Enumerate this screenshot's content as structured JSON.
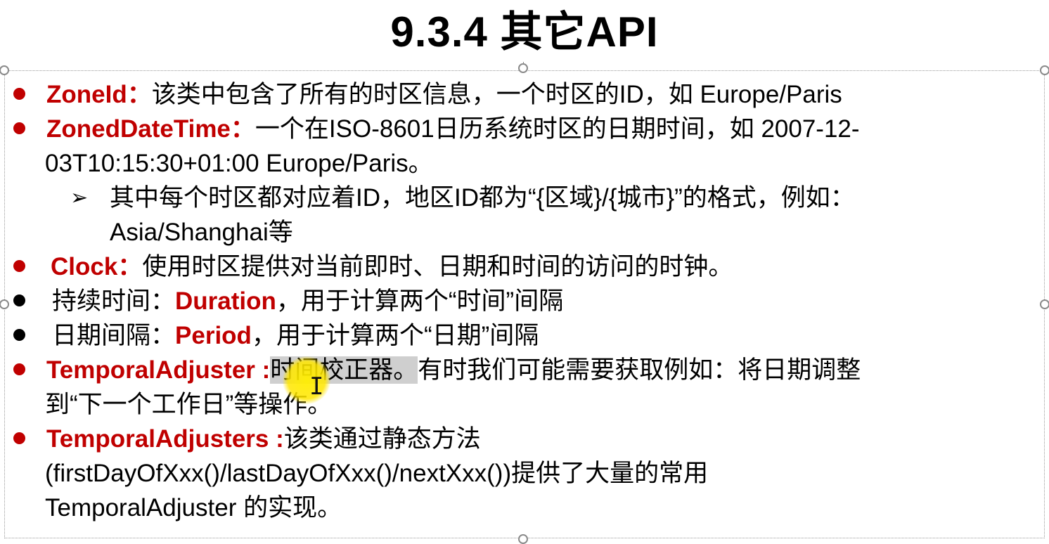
{
  "slide": {
    "title": "9.3.4 其它API",
    "items": [
      {
        "term": "ZoneId：",
        "text": "该类中包含了所有的时区信息，一个时区的ID，如 Europe/Paris"
      },
      {
        "term": "ZonedDateTime：",
        "text_line1": "一个在ISO-8601日历系统时区的日期时间，如 2007-12-",
        "text_line2": "03T10:15:30+01:00 Europe/Paris。"
      },
      {
        "sub_marker": "➢",
        "text_line1": "其中每个时区都对应着ID，地区ID都为“{区域}/{城市}”的格式，例如：",
        "text_line2": "Asia/Shanghai等"
      },
      {
        "term": "Clock：",
        "text": "使用时区提供对当前即时、日期和时间的访问的时钟。"
      },
      {
        "prefix": "持续时间：",
        "term": "Duration",
        "text": "，用于计算两个“时间”间隔"
      },
      {
        "prefix": "日期间隔：",
        "term": "Period",
        "text": "，用于计算两个“日期”间隔"
      },
      {
        "term": "TemporalAdjuster :",
        "highlighted": "时间校正器。",
        "text_line1": "有时我们可能需要获取例如：将日期调整",
        "text_line2": "到“下一个工作日”等操作。"
      },
      {
        "term": "TemporalAdjusters :",
        "text_line1": "该类通过静态方法",
        "text_line2": "(firstDayOfXxx()/lastDayOfXxx()/nextXxx())提供了大量的常用",
        "text_line3": "TemporalAdjuster 的实现。"
      }
    ]
  },
  "colors": {
    "term_red": "#c00000",
    "bullet_black": "#000000",
    "highlight": "#cfcfcf",
    "cursor_halo": "#ffe600"
  },
  "icons": {
    "cursor": "text-cursor-icon",
    "sub_bullet": "arrow-bullet-icon"
  }
}
